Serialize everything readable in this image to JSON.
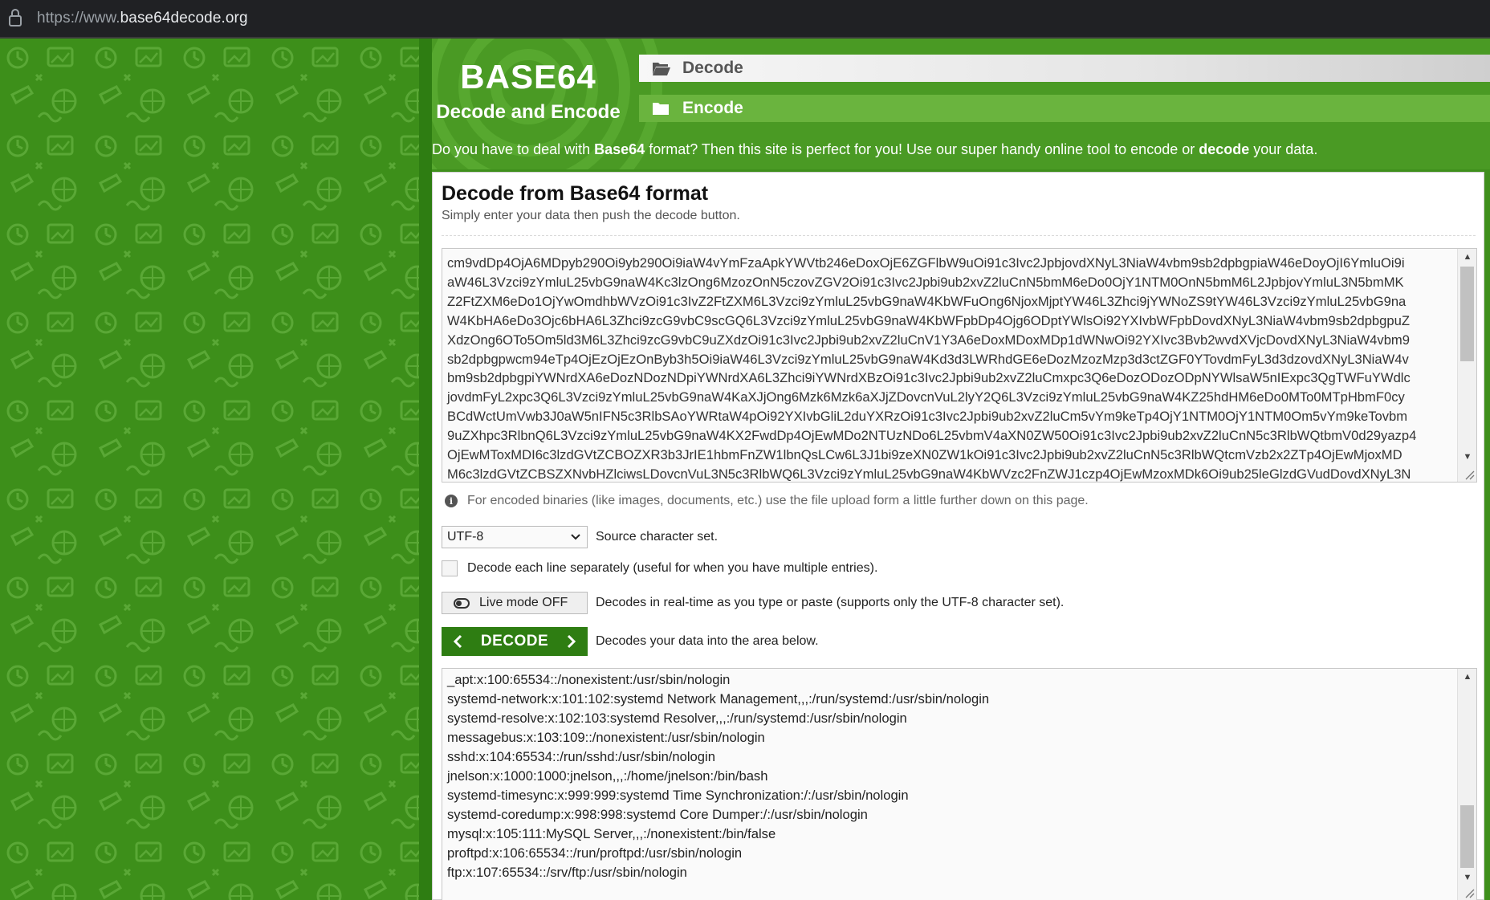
{
  "browser": {
    "url_prefix": "https://www.",
    "url_domain": "base64decode.org"
  },
  "header": {
    "logo_big": "BASE64",
    "logo_small": "Decode and Encode",
    "tab_decode": "Decode",
    "tab_encode": "Encode"
  },
  "tagline": {
    "p1": "Do you have to deal with ",
    "b1": "Base64",
    "p2": " format? Then this site is perfect for you! Use our super handy online tool to encode or ",
    "b2": "decode",
    "p3": " your data."
  },
  "card": {
    "title": "Decode from Base64 format",
    "subtitle": "Simply enter your data then push the decode button."
  },
  "input": {
    "lines": [
      "cm9vdDp4OjA6MDpyb290Oi9yb290Oi9iaW4vYmFzaApkYWVtb246eDoxOjE6ZGFlbW9uOi91c3Ivc2JpbjovdXNyL3NiaW4vbm9sb2dpbgpiaW46eDoyOjI6YmluOi9i",
      "aW46L3Vzci9zYmluL25vbG9naW4Kc3lzOng6MzozOnN5czovZGV2Oi91c3Ivc2Jpbi9ub2xvZ2luCnN5bmM6eDo0OjY1NTM0OnN5bmM6L2JpbjovYmluL3N5bmMK",
      "Z2FtZXM6eDo1OjYwOmdhbWVzOi91c3IvZ2FtZXM6L3Vzci9zYmluL25vbG9naW4KbWFuOng6NjoxMjptYW46L3Zhci9jYWNoZS9tYW46L3Vzci9zYmluL25vbG9na",
      "W4KbHA6eDo3Ojc6bHA6L3Zhci9zcG9vbC9scGQ6L3Vzci9zYmluL25vbG9naW4KbWFpbDp4Ojg6ODptYWlsOi92YXIvbWFpbDovdXNyL3NiaW4vbm9sb2dpbgpuZ",
      "XdzOng6OTo5Om5ld3M6L3Zhci9zcG9vbC9uZXdzOi91c3Ivc2Jpbi9ub2xvZ2luCnV1Y3A6eDoxMDoxMDp1dWNwOi92YXIvc3Bvb2wvdXVjcDovdXNyL3NiaW4vbm9",
      "sb2dpbgpwcm94eTp4OjEzOjEzOnByb3h5Oi9iaW46L3Vzci9zYmluL25vbG9naW4Kd3d3LWRhdGE6eDozMzozMzp3d3ctZGF0YTovdmFyL3d3dzovdXNyL3NiaW4v",
      "bm9sb2dpbgpiYWNrdXA6eDozNDozNDpiYWNrdXA6L3Zhci9iYWNrdXBzOi91c3Ivc2Jpbi9ub2xvZ2luCmxpc3Q6eDozODozODpNYWlsaW5nIExpc3QgTWFuYWdlc",
      "jovdmFyL2xpc3Q6L3Vzci9zYmluL25vbG9naW4KaXJjOng6Mzk6Mzk6aXJjZDovcnVuL2lyY2Q6L3Vzci9zYmluL25vbG9naW4KZ25hdHM6eDo0MTo0MTpHbmF0cy",
      "BCdWctUmVwb3J0aW5nIFN5c3RlbSAoYWRtaW4pOi92YXIvbGliL2duYXRzOi91c3Ivc2Jpbi9ub2xvZ2luCm5vYm9keTp4OjY1NTM0OjY1NTM0Om5vYm9keTovbm",
      "9uZXhpc3RlbnQ6L3Vzci9zYmluL25vbG9naW4KX2FwdDp4OjEwMDo2NTUzNDo6L25vbmV4aXN0ZW50Oi91c3Ivc2Jpbi9ub2xvZ2luCnN5c3RlbWQtbmV0d29yazp4",
      "OjEwMToxMDI6c3lzdGVtZCBOZXR3b3JrIE1hbmFnZW1lbnQsLCw6L3J1bi9zeXN0ZW1kOi91c3Ivc2Jpbi9ub2xvZ2luCnN5c3RlbWQtcmVzb2x2ZTp4OjEwMjoxMD",
      "M6c3lzdGVtZCBSZXNvbHZlciwsLDovcnVuL3N5c3RlbWQ6L3Vzci9zYmluL25vbG9naW4KbWVzc2FnZWJ1czp4OjEwMzoxMDk6Oi9ub25leGlzdGVudDovdXNyL3N"
    ]
  },
  "info_note": "For encoded binaries (like images, documents, etc.) use the file upload form a little further down on this page.",
  "charset": {
    "value": "UTF-8",
    "label": "Source character set."
  },
  "each_line": {
    "label": "Decode each line separately (useful for when you have multiple entries)."
  },
  "live_mode": {
    "button": "Live mode OFF",
    "label": "Decodes in real-time as you type or paste (supports only the UTF-8 character set)."
  },
  "decode": {
    "button": "DECODE",
    "label": "Decodes your data into the area below."
  },
  "output": {
    "lines": [
      "_apt:x:100:65534::/nonexistent:/usr/sbin/nologin",
      "systemd-network:x:101:102:systemd Network Management,,,:/run/systemd:/usr/sbin/nologin",
      "systemd-resolve:x:102:103:systemd Resolver,,,:/run/systemd:/usr/sbin/nologin",
      "messagebus:x:103:109::/nonexistent:/usr/sbin/nologin",
      "sshd:x:104:65534::/run/sshd:/usr/sbin/nologin",
      "jnelson:x:1000:1000:jnelson,,,:/home/jnelson:/bin/bash",
      "systemd-timesync:x:999:999:systemd Time Synchronization:/:/usr/sbin/nologin",
      "systemd-coredump:x:998:998:systemd Core Dumper:/:/usr/sbin/nologin",
      "mysql:x:105:111:MySQL Server,,,:/nonexistent:/bin/false",
      "proftpd:x:106:65534::/run/proftpd:/usr/sbin/nologin",
      "ftp:x:107:65534::/srv/ftp:/usr/sbin/nologin"
    ]
  },
  "colors": {
    "brand_green": "#2e7d12",
    "pattern_green": "#3d8f1a",
    "tab_encode_green": "#6ab43e"
  }
}
